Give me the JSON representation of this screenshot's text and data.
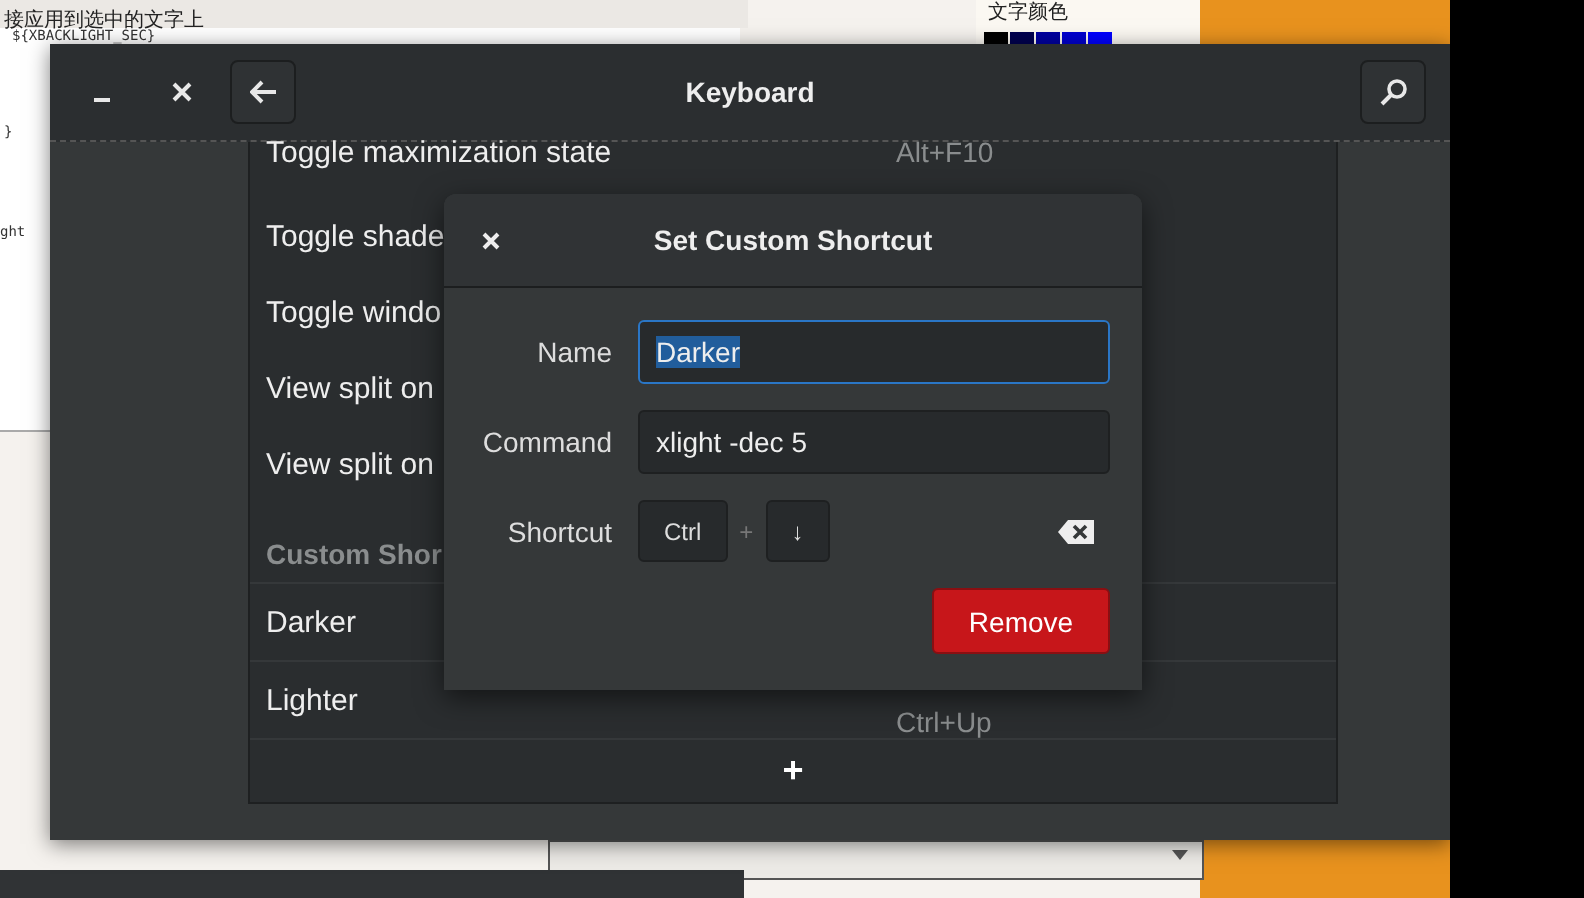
{
  "background_window": {
    "heading": "接应用到选中的文字上",
    "side_label": "文字颜色",
    "code_lines": [
      "${XBACKLIGHT_SEC}",
      "}",
      "ght"
    ]
  },
  "window": {
    "title": "Keyboard"
  },
  "shortcuts": [
    {
      "name": "Toggle maximization state",
      "accel": "Alt+F10"
    },
    {
      "name": "Toggle shade"
    },
    {
      "name": "Toggle windo"
    },
    {
      "name": "View split on"
    },
    {
      "name": "View split on"
    }
  ],
  "section": "Custom Shor",
  "custom_shortcuts": [
    {
      "name": "Darker"
    },
    {
      "name": "Lighter",
      "accel": "Ctrl+Up"
    }
  ],
  "add_button": "+",
  "dialog": {
    "title": "Set Custom Shortcut",
    "fields": [
      {
        "label": "Name",
        "value": "Darker",
        "focused": true
      },
      {
        "label": "Command",
        "value": "xlight -dec 5",
        "focused": false
      }
    ],
    "shortcut_label": "Shortcut",
    "keys": [
      "Ctrl",
      "↓"
    ],
    "key_separator": "+",
    "remove_button": "Remove"
  }
}
